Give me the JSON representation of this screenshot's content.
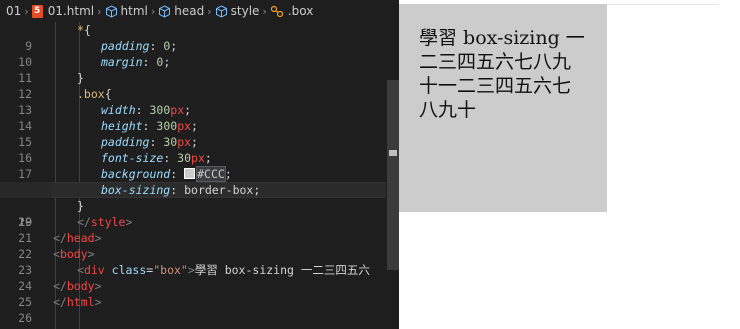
{
  "breadcrumb": {
    "folder": "01",
    "file": "01.html",
    "items": [
      "html",
      "head",
      "style",
      ".box"
    ]
  },
  "editor": {
    "active_line": 19,
    "lines": [
      {
        "n": "9"
      },
      {
        "n": "10"
      },
      {
        "n": "11"
      },
      {
        "n": "12"
      },
      {
        "n": "13"
      },
      {
        "n": "14"
      },
      {
        "n": "15"
      },
      {
        "n": "16"
      },
      {
        "n": "17"
      },
      {
        "n": "18"
      },
      {
        "n": "19"
      },
      {
        "n": "20"
      },
      {
        "n": "21"
      },
      {
        "n": "22"
      },
      {
        "n": "23"
      },
      {
        "n": "24"
      },
      {
        "n": "25"
      },
      {
        "n": "26"
      }
    ],
    "code": {
      "l9_sel": "*",
      "l9_brace": "{",
      "l10_prop": "padding",
      "l10_val": "0",
      "l11_prop": "margin",
      "l11_val": "0",
      "l12": "}",
      "l13_sel": ".box",
      "l13_brace": "{",
      "l14_prop": "width",
      "l14_num": "300",
      "l14_unit": "px",
      "l15_prop": "height",
      "l15_num": "300",
      "l15_unit": "px",
      "l16_prop": "padding",
      "l16_num": "30",
      "l16_unit": "px",
      "l17_prop": "font-size",
      "l17_num": "30",
      "l17_unit": "px",
      "l18_prop": "background",
      "l18_val": "#CCC",
      "l19_prop": "box-sizing",
      "l19_val": "border-box",
      "l20": "}",
      "l21_tag": "style",
      "l22_tag": "head",
      "l23_tag": "body",
      "l24_tag": "div",
      "l24_attr": "class",
      "l24_str": "\"box\"",
      "l24_text": "學習 box-sizing 一二三四五六",
      "l25_tag": "body",
      "l26_tag": "html"
    }
  },
  "preview": {
    "box_text": "學習 box-sizing 一二三四五六七八九十一二三四五六七八九十",
    "box_color": "#cccccc"
  },
  "colors": {
    "editor_bg": "#1e1e1e",
    "selector": "#d7ba7d",
    "property": "#9cdcfe",
    "number": "#b5cea8",
    "tag": "#f44747",
    "string": "#ce9178"
  }
}
